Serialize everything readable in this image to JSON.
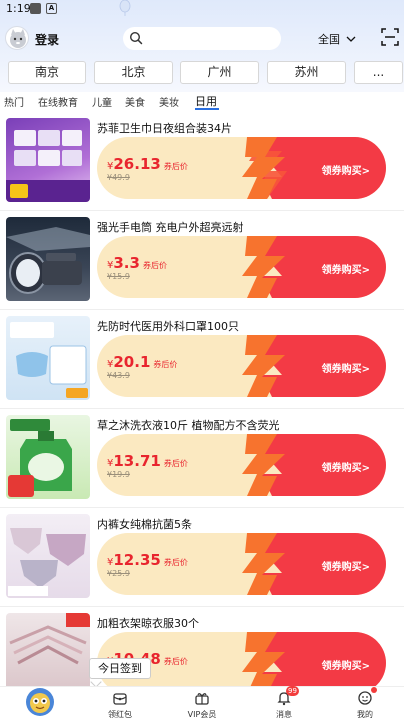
{
  "status_bar": {
    "time": "1:19",
    "icon_a": "A"
  },
  "header": {
    "login_label": "登录",
    "region_label": "全国"
  },
  "cities": [
    "南京",
    "北京",
    "广州",
    "苏州",
    "..."
  ],
  "categories": [
    {
      "label": "热门",
      "active": false
    },
    {
      "label": "在线教育",
      "active": false
    },
    {
      "label": "儿童",
      "active": false
    },
    {
      "label": "美食",
      "active": false
    },
    {
      "label": "美妆",
      "active": false
    },
    {
      "label": "日用",
      "active": true
    }
  ],
  "product_common": {
    "currency": "¥",
    "after_coupon": "券后价",
    "buy_label": "领券购买>"
  },
  "products": [
    {
      "title": "苏菲卫生巾日夜组合装34片",
      "price": "26.13",
      "original": "¥49.9"
    },
    {
      "title": "强光手电筒 充电户外超亮远射",
      "price": "3.3",
      "original": "¥15.9"
    },
    {
      "title": "先防时代医用外科口罩100只",
      "price": "20.1",
      "original": "¥43.9"
    },
    {
      "title": "草之沐洗衣液10斤 植物配方不含荧光",
      "price": "13.71",
      "original": "¥19.9"
    },
    {
      "title": "内裤女纯棉抗菌5条",
      "price": "12.35",
      "original": "¥25.9"
    },
    {
      "title": "加粗衣架晾衣服30个",
      "price": "10.48",
      "original": ""
    }
  ],
  "checkin": {
    "label": "今日签到"
  },
  "tabbar": {
    "items": [
      {
        "label": "",
        "icon": "home-icon"
      },
      {
        "label": "领红包",
        "icon": "red-envelope-icon"
      },
      {
        "label": "VIP会员",
        "icon": "vip-gift-icon"
      },
      {
        "label": "消息",
        "icon": "bell-icon",
        "badge": "99"
      },
      {
        "label": "我的",
        "icon": "profile-icon"
      }
    ]
  },
  "colors": {
    "accent_red": "#e8252e",
    "card_cream": "#fbe9c1",
    "underline_blue": "#2a6fe0"
  }
}
